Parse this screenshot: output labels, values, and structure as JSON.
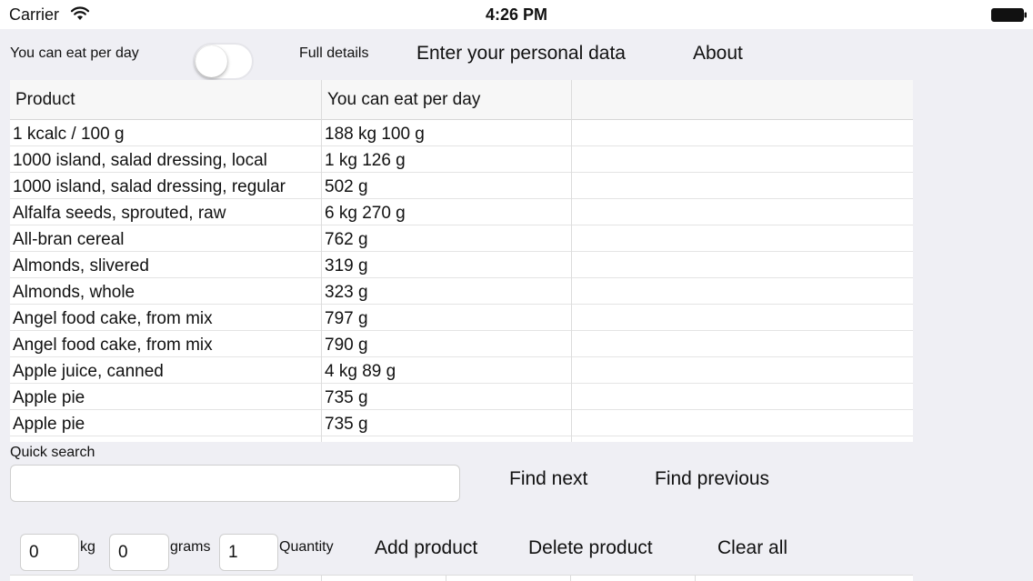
{
  "status_bar": {
    "carrier": "Carrier",
    "time": "4:26 PM"
  },
  "top_bar": {
    "eat_label": "You can eat per day",
    "full_details_label": "Full details",
    "full_details_toggle_on": false,
    "personal_data_button": "Enter your personal data",
    "about_button": "About"
  },
  "table": {
    "headers": [
      "Product",
      "You can eat per day",
      ""
    ],
    "rows": [
      {
        "product": "1 kcalc / 100 g",
        "amount": "188 kg 100 g"
      },
      {
        "product": "1000 island, salad dressing, local",
        "amount": "1 kg 126 g"
      },
      {
        "product": "1000 island, salad dressing, regular",
        "amount": "502 g"
      },
      {
        "product": "Alfalfa seeds, sprouted, raw",
        "amount": "6 kg 270 g"
      },
      {
        "product": "All-bran cereal",
        "amount": "762 g"
      },
      {
        "product": "Almonds, slivered",
        "amount": "319 g"
      },
      {
        "product": "Almonds, whole",
        "amount": "323 g"
      },
      {
        "product": "Angel food cake, from mix",
        "amount": "797 g"
      },
      {
        "product": "Angel food cake, from mix",
        "amount": "790 g"
      },
      {
        "product": "Apple juice, canned",
        "amount": "4 kg 89 g"
      },
      {
        "product": "Apple pie",
        "amount": "735 g"
      },
      {
        "product": "Apple pie",
        "amount": "735 g"
      }
    ]
  },
  "search": {
    "label": "Quick search",
    "value": "",
    "find_next_button": "Find next",
    "find_previous_button": "Find previous"
  },
  "entry": {
    "kg_value": "0",
    "kg_label": "kg",
    "grams_value": "0",
    "grams_label": "grams",
    "quantity_value": "1",
    "quantity_label": "Quantity",
    "add_button": "Add product",
    "delete_button": "Delete product",
    "clear_button": "Clear all"
  }
}
